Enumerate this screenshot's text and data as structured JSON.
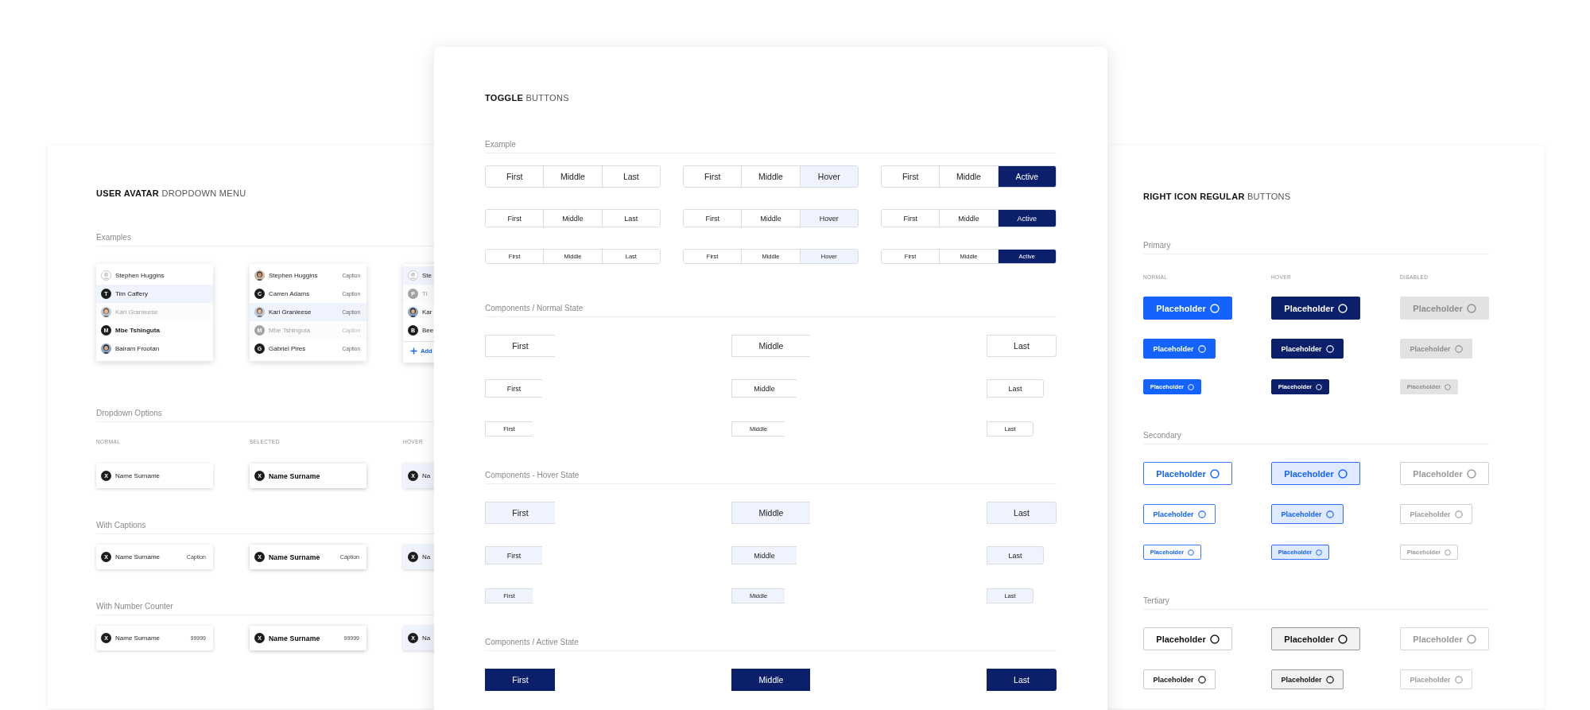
{
  "left_panel": {
    "title": "**USER AVATAR** DROPDOWN MENU",
    "examples_heading": "Examples",
    "menus": [
      {
        "items": [
          {
            "kind": "silhouette",
            "name": "Stephen Huggins",
            "selected": false,
            "disabled": false,
            "hovered": false
          },
          {
            "kind": "letter",
            "letter": "T",
            "name": "Tim Caffery",
            "selected": false,
            "disabled": false,
            "hovered": true
          },
          {
            "kind": "photo",
            "name": "Kari Granleese",
            "selected": false,
            "disabled": true,
            "hovered": false
          },
          {
            "kind": "letter",
            "letter": "M",
            "name": "Mbe Tshinguta",
            "selected": true,
            "disabled": false,
            "hovered": false
          },
          {
            "kind": "photo",
            "name": "Bairam Frootan",
            "selected": false,
            "disabled": false,
            "hovered": false
          }
        ]
      },
      {
        "items": [
          {
            "kind": "photo",
            "name": "Stephen Huggins",
            "caption": "Caption",
            "selected": false,
            "disabled": false,
            "hovered": false
          },
          {
            "kind": "letter",
            "letter": "C",
            "name": "Carren Adams",
            "caption": "Caption",
            "selected": false,
            "disabled": false,
            "hovered": false
          },
          {
            "kind": "photo",
            "name": "Kari Granleese",
            "caption": "Caption",
            "selected": false,
            "disabled": false,
            "hovered": true
          },
          {
            "kind": "letter",
            "letter": "M",
            "name": "Mbe Tshinguta",
            "caption": "Caption",
            "selected": false,
            "disabled": true,
            "hovered": false
          },
          {
            "kind": "letter",
            "letter": "G",
            "name": "Gabriel Pires",
            "caption": "Caption",
            "selected": false,
            "disabled": false,
            "hovered": false
          }
        ]
      },
      {
        "items": [
          {
            "kind": "silhouette",
            "name": "Ste",
            "selected": false,
            "disabled": false,
            "hovered": true
          },
          {
            "kind": "letter",
            "letter": "P",
            "name": "Ti",
            "selected": false,
            "disabled": true,
            "hovered": false
          },
          {
            "kind": "photo",
            "name": "Kar",
            "selected": false,
            "disabled": false,
            "hovered": false
          },
          {
            "kind": "letter",
            "letter": "B",
            "name": "Bee",
            "selected": false,
            "disabled": false,
            "hovered": false
          }
        ],
        "add_label": "Add"
      }
    ],
    "option_sections": [
      {
        "heading": "Dropdown Options",
        "column_labels": [
          "NORMAL",
          "SELECTED",
          "HOVER"
        ],
        "options": [
          {
            "letter": "X",
            "name": "Name Surname",
            "selected": false,
            "hovered": false
          },
          {
            "letter": "X",
            "name": "Name Surname",
            "selected": true,
            "hovered": false
          },
          {
            "letter": "X",
            "name": "Na",
            "selected": false,
            "hovered": true
          }
        ]
      },
      {
        "heading": "With Captions",
        "options": [
          {
            "letter": "X",
            "name": "Name Surname",
            "trailing": "Caption",
            "selected": false,
            "hovered": false
          },
          {
            "letter": "X",
            "name": "Name Surname",
            "trailing": "Caption",
            "selected": true,
            "hovered": false
          },
          {
            "letter": "X",
            "name": "Na",
            "selected": false,
            "hovered": true
          }
        ]
      },
      {
        "heading": "With Number Counter",
        "options": [
          {
            "letter": "X",
            "name": "Name Surname",
            "trailing": "99999",
            "selected": false,
            "hovered": false
          },
          {
            "letter": "X",
            "name": "Name Surname",
            "trailing": "99999",
            "selected": true,
            "hovered": false
          },
          {
            "letter": "X",
            "name": "Na",
            "selected": false,
            "hovered": true
          }
        ]
      }
    ]
  },
  "middle_panel": {
    "title": "**TOGGLE** BUTTONS",
    "example": {
      "heading": "Example",
      "rows": [
        {
          "groups": [
            {
              "segments": [
                {
                  "label": "First",
                  "selected": false,
                  "hovered": false
                },
                {
                  "label": "Middle",
                  "selected": false,
                  "hovered": false
                },
                {
                  "label": "Last",
                  "selected": false,
                  "hovered": false
                }
              ]
            },
            {
              "segments": [
                {
                  "label": "First",
                  "selected": false,
                  "hovered": false
                },
                {
                  "label": "Middle",
                  "selected": false,
                  "hovered": false
                },
                {
                  "label": "Hover",
                  "selected": false,
                  "hovered": true
                }
              ]
            },
            {
              "segments": [
                {
                  "label": "First",
                  "selected": false,
                  "hovered": false
                },
                {
                  "label": "Middle",
                  "selected": false,
                  "hovered": false
                },
                {
                  "label": "Active",
                  "selected": true,
                  "hovered": false
                }
              ]
            }
          ]
        },
        {
          "groups": [
            {
              "segments": [
                {
                  "label": "First",
                  "selected": false,
                  "hovered": false
                },
                {
                  "label": "Middle",
                  "selected": false,
                  "hovered": false
                },
                {
                  "label": "Last",
                  "selected": false,
                  "hovered": false
                }
              ]
            },
            {
              "segments": [
                {
                  "label": "First",
                  "selected": false,
                  "hovered": false
                },
                {
                  "label": "Middle",
                  "selected": false,
                  "hovered": false
                },
                {
                  "label": "Hover",
                  "selected": false,
                  "hovered": true
                }
              ]
            },
            {
              "segments": [
                {
                  "label": "First",
                  "selected": false,
                  "hovered": false
                },
                {
                  "label": "Middle",
                  "selected": false,
                  "hovered": false
                },
                {
                  "label": "Active",
                  "selected": true,
                  "hovered": false
                }
              ]
            }
          ]
        },
        {
          "groups": [
            {
              "segments": [
                {
                  "label": "First",
                  "selected": false,
                  "hovered": false
                },
                {
                  "label": "Middle",
                  "selected": false,
                  "hovered": false
                },
                {
                  "label": "Last",
                  "selected": false,
                  "hovered": false
                }
              ]
            },
            {
              "segments": [
                {
                  "label": "First",
                  "selected": false,
                  "hovered": false
                },
                {
                  "label": "Middle",
                  "selected": false,
                  "hovered": false
                },
                {
                  "label": "Hover",
                  "selected": false,
                  "hovered": true
                }
              ]
            },
            {
              "segments": [
                {
                  "label": "First",
                  "selected": false,
                  "hovered": false
                },
                {
                  "label": "Middle",
                  "selected": false,
                  "hovered": false
                },
                {
                  "label": "Active",
                  "selected": true,
                  "hovered": false
                }
              ]
            }
          ]
        }
      ]
    },
    "component_sections": [
      {
        "heading": "Components / Normal State",
        "kind": "normal",
        "rows": [
          [
            "First",
            "Middle",
            "Last"
          ],
          [
            "First",
            "Middle",
            "Last"
          ],
          [
            "First",
            "Middle",
            "Last"
          ]
        ]
      },
      {
        "heading": "Components - Hover State",
        "kind": "hover",
        "rows": [
          [
            "First",
            "Middle",
            "Last"
          ],
          [
            "First",
            "Middle",
            "Last"
          ],
          [
            "First",
            "Middle",
            "Last"
          ]
        ]
      },
      {
        "heading": "Components / Active State",
        "kind": "active",
        "rows": [
          [
            "First",
            "Middle",
            "Last"
          ]
        ]
      }
    ]
  },
  "right_panel": {
    "title": "**RIGHT ICON REGULAR** BUTTONS",
    "sections": [
      {
        "heading": "Primary",
        "kind": "primary",
        "column_labels": [
          "NORMAL",
          "HOVER",
          "DISABLED"
        ],
        "rows": [
          [
            {
              "label": "Placeholder",
              "hovered": false,
              "disabled": false
            },
            {
              "label": "Placeholder",
              "hovered": true,
              "disabled": false
            },
            {
              "label": "Placeholder",
              "hovered": false,
              "disabled": true
            }
          ],
          [
            {
              "label": "Placeholder",
              "hovered": false,
              "disabled": false
            },
            {
              "label": "Placeholder",
              "hovered": true,
              "disabled": false
            },
            {
              "label": "Placeholder",
              "hovered": false,
              "disabled": true
            }
          ],
          [
            {
              "label": "Placeholder",
              "hovered": false,
              "disabled": false
            },
            {
              "label": "Placeholder",
              "hovered": true,
              "disabled": false
            },
            {
              "label": "Placeholder",
              "hovered": false,
              "disabled": true
            }
          ]
        ]
      },
      {
        "heading": "Secondary",
        "kind": "secondary",
        "rows": [
          [
            {
              "label": "Placeholder",
              "hovered": false,
              "disabled": false
            },
            {
              "label": "Placeholder",
              "hovered": true,
              "disabled": false
            },
            {
              "label": "Placeholder",
              "hovered": false,
              "disabled": true
            }
          ],
          [
            {
              "label": "Placeholder",
              "hovered": false,
              "disabled": false
            },
            {
              "label": "Placeholder",
              "hovered": true,
              "disabled": false
            },
            {
              "label": "Placeholder",
              "hovered": false,
              "disabled": true
            }
          ],
          [
            {
              "label": "Placeholder",
              "hovered": false,
              "disabled": false
            },
            {
              "label": "Placeholder",
              "hovered": true,
              "disabled": false
            },
            {
              "label": "Placeholder",
              "hovered": false,
              "disabled": true
            }
          ]
        ]
      },
      {
        "heading": "Tertiary",
        "kind": "tertiary",
        "rows": [
          [
            {
              "label": "Placeholder",
              "hovered": false,
              "disabled": false
            },
            {
              "label": "Placeholder",
              "hovered": true,
              "disabled": false
            },
            {
              "label": "Placeholder",
              "hovered": false,
              "disabled": true
            }
          ],
          [
            {
              "label": "Placeholder",
              "hovered": false,
              "disabled": false
            },
            {
              "label": "Placeholder",
              "hovered": true,
              "disabled": false
            },
            {
              "label": "Placeholder",
              "hovered": false,
              "disabled": true
            }
          ]
        ]
      }
    ]
  }
}
